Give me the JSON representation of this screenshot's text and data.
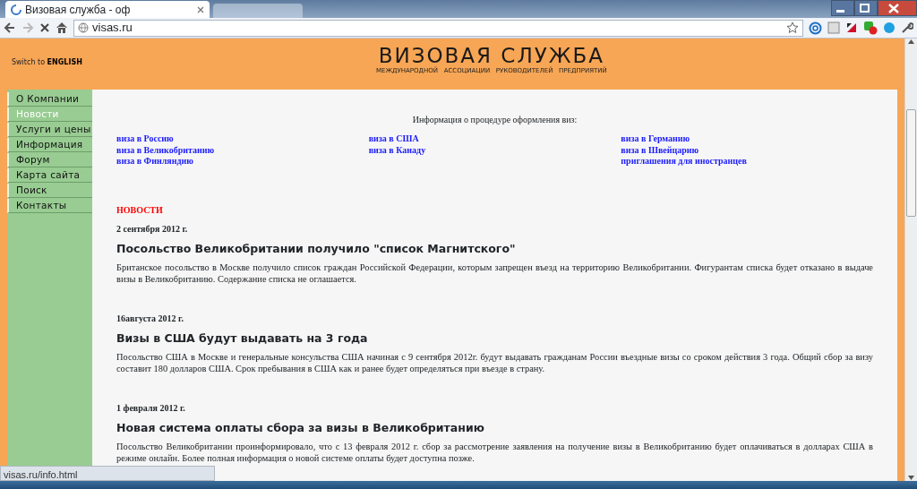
{
  "browser": {
    "tab": {
      "title": "Визовая служба - оф",
      "selected": true
    },
    "address": "visas.ru",
    "status_url": "visas.ru/info.html"
  },
  "header": {
    "switch_label": "Switch to",
    "switch_link": "ENGLISH",
    "logo_title": "ВИЗОВАЯ СЛУЖБА",
    "logo_subtitle": "МЕЖДУНАРОДНОЙ   АССОЦИАЦИИ   РУКОВОДИТЕЛЕЙ   ПРЕДПРИЯТИЙ"
  },
  "sidebar": {
    "items": [
      {
        "label": "О Компании",
        "selected": false
      },
      {
        "label": "Новости",
        "selected": true
      },
      {
        "label": "Услуги и цены",
        "selected": false
      },
      {
        "label": "Информация",
        "selected": false
      },
      {
        "label": "Форум",
        "selected": false
      },
      {
        "label": "Карта сайта",
        "selected": false
      },
      {
        "label": "Поиск",
        "selected": false
      },
      {
        "label": "Контакты",
        "selected": false
      }
    ]
  },
  "info": {
    "title": "Информация о процедуре оформления виз:",
    "columns": [
      [
        "виза в Россию",
        "виза в Великобританию",
        "виза в Финляндию"
      ],
      [
        "виза в США",
        "виза в Канаду"
      ],
      [
        "виза в Германию",
        "виза в Швейцарию",
        "приглашения для иностранцев"
      ]
    ]
  },
  "news": {
    "heading": "НОВОСТИ",
    "items": [
      {
        "date": "2 сентября 2012 г.",
        "title": "Посольство Великобритании получило \"список Магнитского\"",
        "body": "Британское посольство в Москве получило список граждан Российской Федерации, которым запрещен въезд на территорию Великобритании. Фигурантам списка будет отказано в выдаче визы в Великобританию. Содержание списка не оглашается."
      },
      {
        "date": "16августа 2012 г.",
        "title": "Визы в США будут выдавать на 3 года",
        "body": "Посольство США в Москве и генеральные консульства США начиная с 9 сентября 2012г. будут выдавать гражданам России въездные визы со сроком действия 3 года. Общий сбор за визу составит 180 долларов США. Срок пребывания в США как и ранее будет определяться при въезде в страну."
      },
      {
        "date": "1 февраля 2012 г.",
        "title": "Новая система оплаты сбора за визы в Великобританию",
        "body": "Посольство Великобритании проинформировало, что с 13 февраля 2012 г. сбор за рассмотрение заявления на получение визы в Великобританию будет оплачиваться в долларах США в режиме онлайн. Более полная информация о новой системе оплаты будет доступна позже."
      }
    ]
  }
}
